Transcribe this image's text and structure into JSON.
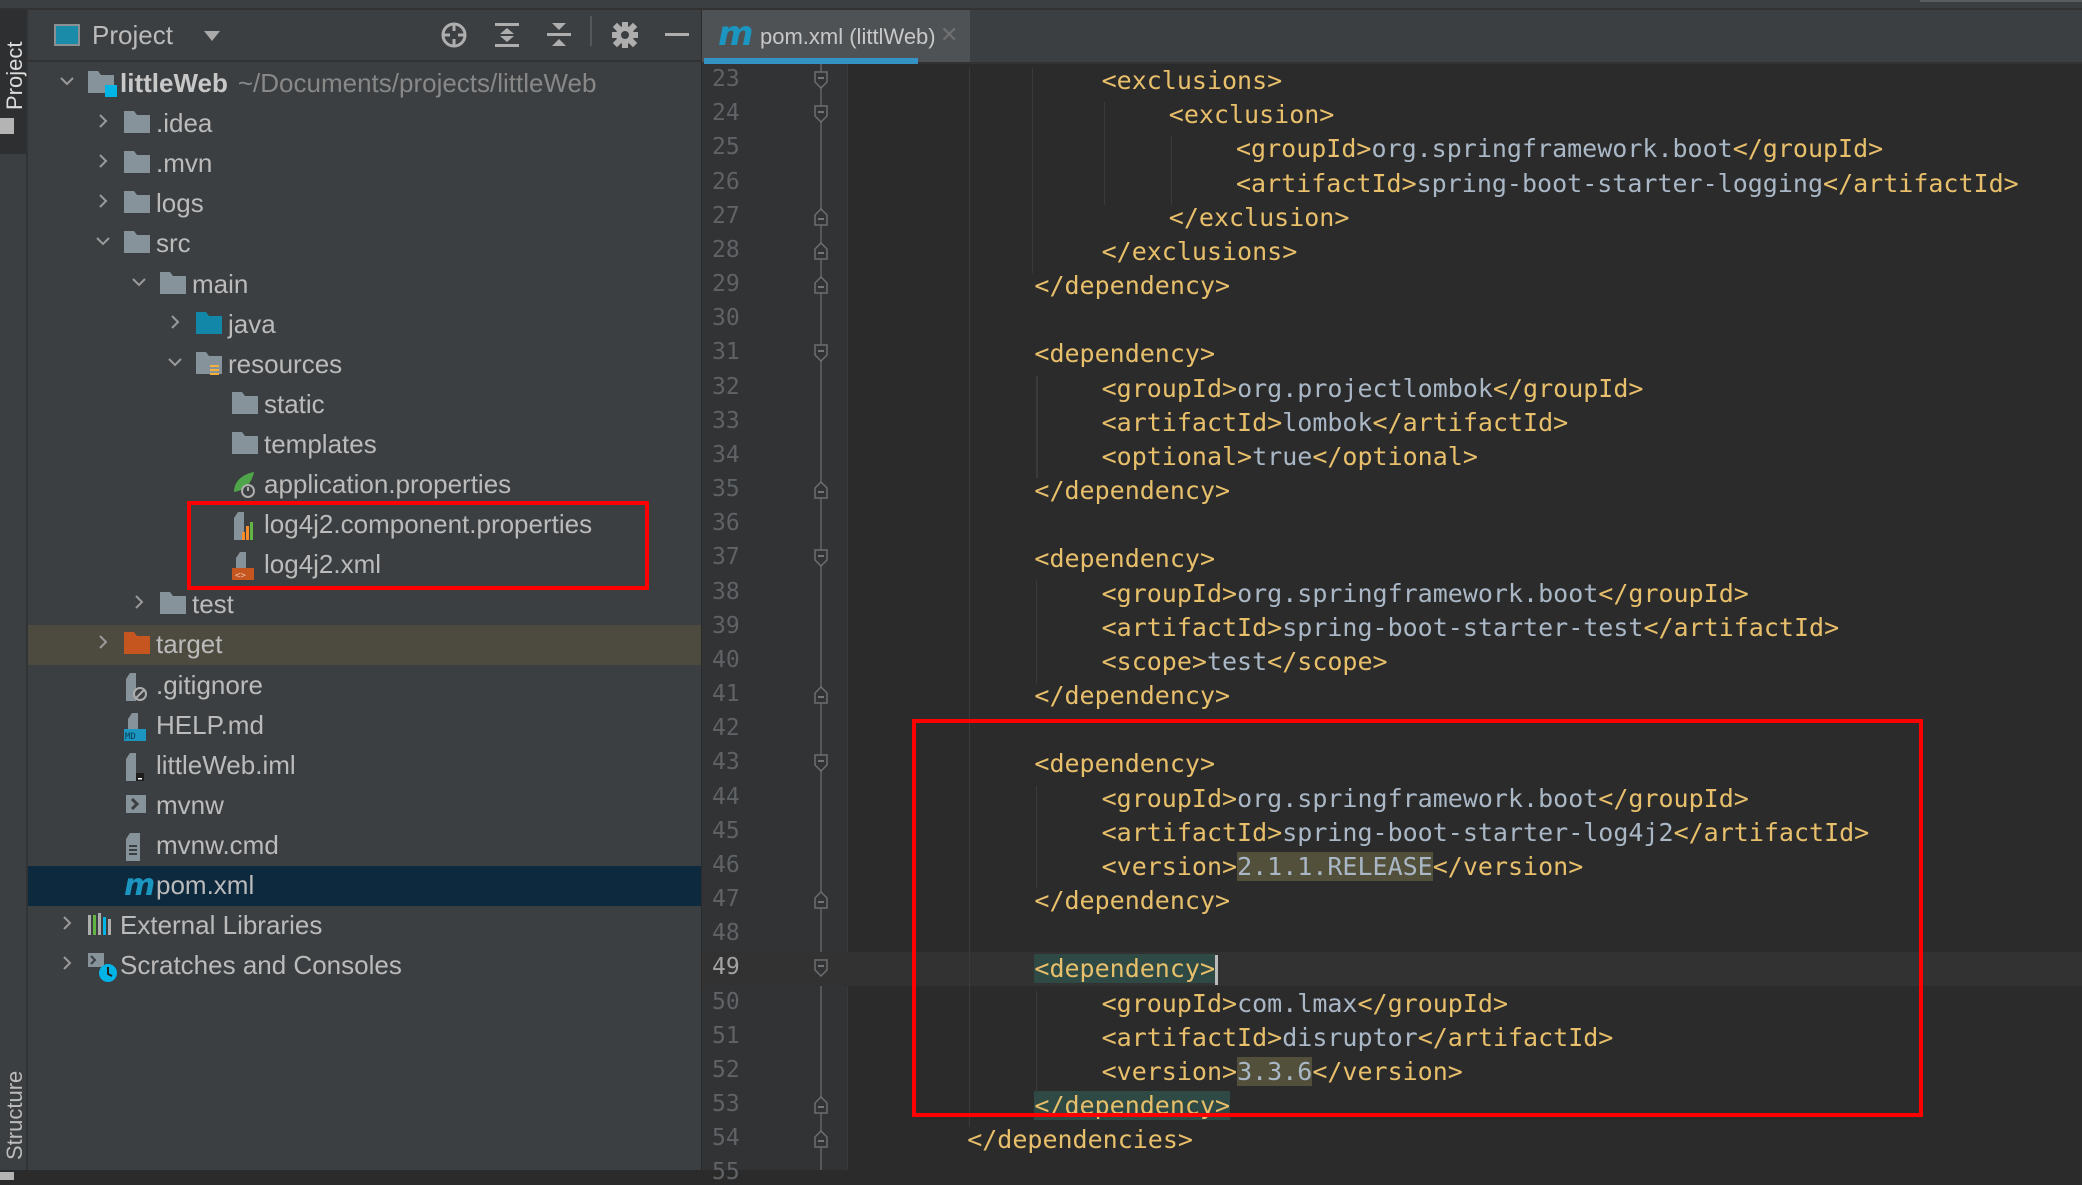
{
  "window": {
    "left_strip": {
      "top_tab": "Project",
      "bottom_tab": "Structure"
    }
  },
  "project_panel": {
    "title": "Project",
    "toolbar": {
      "locate_icon": "crosshair-icon",
      "expand_all_icon": "expand-all-icon",
      "collapse_all_icon": "collapse-all-icon",
      "settings_icon": "gear-icon",
      "hide_icon": "minimize-icon"
    },
    "tree": [
      {
        "label": "littleWeb",
        "path": "~/Documents/projects/littleWeb",
        "depth": 0,
        "expanded": true,
        "icon": "module-folder-icon",
        "bold": true
      },
      {
        "label": ".idea",
        "depth": 1,
        "expanded": false,
        "icon": "folder-icon"
      },
      {
        "label": ".mvn",
        "depth": 1,
        "expanded": false,
        "icon": "folder-icon"
      },
      {
        "label": "logs",
        "depth": 1,
        "expanded": false,
        "icon": "folder-icon"
      },
      {
        "label": "src",
        "depth": 1,
        "expanded": true,
        "icon": "folder-icon"
      },
      {
        "label": "main",
        "depth": 2,
        "expanded": true,
        "icon": "folder-icon"
      },
      {
        "label": "java",
        "depth": 3,
        "expanded": false,
        "icon": "source-folder-icon"
      },
      {
        "label": "resources",
        "depth": 3,
        "expanded": true,
        "icon": "resources-folder-icon"
      },
      {
        "label": "static",
        "depth": 4,
        "icon": "folder-icon"
      },
      {
        "label": "templates",
        "depth": 4,
        "icon": "folder-icon"
      },
      {
        "label": "application.properties",
        "depth": 4,
        "icon": "spring-properties-icon"
      },
      {
        "label": "log4j2.component.properties",
        "depth": 4,
        "icon": "properties-file-icon"
      },
      {
        "label": "log4j2.xml",
        "depth": 4,
        "icon": "xml-file-icon"
      },
      {
        "label": "test",
        "depth": 2,
        "expanded": false,
        "icon": "folder-icon"
      },
      {
        "label": "target",
        "depth": 1,
        "expanded": false,
        "icon": "excluded-folder-icon",
        "highlighted": true
      },
      {
        "label": ".gitignore",
        "depth": 1,
        "icon": "gitignore-file-icon"
      },
      {
        "label": "HELP.md",
        "depth": 1,
        "icon": "markdown-file-icon"
      },
      {
        "label": "littleWeb.iml",
        "depth": 1,
        "icon": "iml-file-icon"
      },
      {
        "label": "mvnw",
        "depth": 1,
        "icon": "shell-script-icon"
      },
      {
        "label": "mvnw.cmd",
        "depth": 1,
        "icon": "text-file-icon"
      },
      {
        "label": "pom.xml",
        "depth": 1,
        "icon": "maven-icon",
        "selected": true
      },
      {
        "label": "External Libraries",
        "depth": 0,
        "expanded": false,
        "icon": "libraries-icon"
      },
      {
        "label": "Scratches and Consoles",
        "depth": 0,
        "expanded": false,
        "icon": "scratches-icon"
      }
    ]
  },
  "editor": {
    "tab": {
      "label": "pom.xml (littlWeb)",
      "icon": "maven-icon",
      "close_icon": "close-icon"
    },
    "current_line": 49,
    "lines": [
      {
        "n": 23,
        "indent": 3,
        "parts": [
          [
            "tag",
            "<exclusions>"
          ]
        ],
        "fold": "open"
      },
      {
        "n": 24,
        "indent": 4,
        "parts": [
          [
            "tag",
            "<exclusion>"
          ]
        ],
        "fold": "open"
      },
      {
        "n": 25,
        "indent": 5,
        "parts": [
          [
            "tag",
            "<groupId>"
          ],
          [
            "txt",
            "org.springframework.boot"
          ],
          [
            "tag",
            "</groupId>"
          ]
        ]
      },
      {
        "n": 26,
        "indent": 5,
        "parts": [
          [
            "tag",
            "<artifactId>"
          ],
          [
            "txt",
            "spring-boot-starter-logging"
          ],
          [
            "tag",
            "</artifactId>"
          ]
        ]
      },
      {
        "n": 27,
        "indent": 4,
        "parts": [
          [
            "tag",
            "</exclusion>"
          ]
        ],
        "fold": "close"
      },
      {
        "n": 28,
        "indent": 3,
        "parts": [
          [
            "tag",
            "</exclusions>"
          ]
        ],
        "fold": "close"
      },
      {
        "n": 29,
        "indent": 2,
        "parts": [
          [
            "tag",
            "</dependency>"
          ]
        ],
        "fold": "close"
      },
      {
        "n": 30,
        "indent": 0,
        "parts": []
      },
      {
        "n": 31,
        "indent": 2,
        "parts": [
          [
            "tag",
            "<dependency>"
          ]
        ],
        "fold": "open"
      },
      {
        "n": 32,
        "indent": 3,
        "parts": [
          [
            "tag",
            "<groupId>"
          ],
          [
            "txt",
            "org.projectlombok"
          ],
          [
            "tag",
            "</groupId>"
          ]
        ]
      },
      {
        "n": 33,
        "indent": 3,
        "parts": [
          [
            "tag",
            "<artifactId>"
          ],
          [
            "txt",
            "lombok"
          ],
          [
            "tag",
            "</artifactId>"
          ]
        ]
      },
      {
        "n": 34,
        "indent": 3,
        "parts": [
          [
            "tag",
            "<optional>"
          ],
          [
            "txt",
            "true"
          ],
          [
            "tag",
            "</optional>"
          ]
        ]
      },
      {
        "n": 35,
        "indent": 2,
        "parts": [
          [
            "tag",
            "</dependency>"
          ]
        ],
        "fold": "close"
      },
      {
        "n": 36,
        "indent": 0,
        "parts": []
      },
      {
        "n": 37,
        "indent": 2,
        "parts": [
          [
            "tag",
            "<dependency>"
          ]
        ],
        "fold": "open"
      },
      {
        "n": 38,
        "indent": 3,
        "parts": [
          [
            "tag",
            "<groupId>"
          ],
          [
            "txt",
            "org.springframework.boot"
          ],
          [
            "tag",
            "</groupId>"
          ]
        ]
      },
      {
        "n": 39,
        "indent": 3,
        "parts": [
          [
            "tag",
            "<artifactId>"
          ],
          [
            "txt",
            "spring-boot-starter-test"
          ],
          [
            "tag",
            "</artifactId>"
          ]
        ]
      },
      {
        "n": 40,
        "indent": 3,
        "parts": [
          [
            "tag",
            "<scope>"
          ],
          [
            "txt",
            "test"
          ],
          [
            "tag",
            "</scope>"
          ]
        ]
      },
      {
        "n": 41,
        "indent": 2,
        "parts": [
          [
            "tag",
            "</dependency>"
          ]
        ],
        "fold": "close"
      },
      {
        "n": 42,
        "indent": 0,
        "parts": []
      },
      {
        "n": 43,
        "indent": 2,
        "parts": [
          [
            "tag",
            "<dependency>"
          ]
        ],
        "fold": "open"
      },
      {
        "n": 44,
        "indent": 3,
        "parts": [
          [
            "tag",
            "<groupId>"
          ],
          [
            "txt",
            "org.springframework.boot"
          ],
          [
            "tag",
            "</groupId>"
          ]
        ]
      },
      {
        "n": 45,
        "indent": 3,
        "parts": [
          [
            "tag",
            "<artifactId>"
          ],
          [
            "txt",
            "spring-boot-starter-log4j2"
          ],
          [
            "tag",
            "</artifactId>"
          ]
        ]
      },
      {
        "n": 46,
        "indent": 3,
        "parts": [
          [
            "tag",
            "<version>"
          ],
          [
            "ver",
            "2.1.1.RELEASE"
          ],
          [
            "tag",
            "</version>"
          ]
        ]
      },
      {
        "n": 47,
        "indent": 2,
        "parts": [
          [
            "tag",
            "</dependency>"
          ]
        ],
        "fold": "close"
      },
      {
        "n": 48,
        "indent": 0,
        "parts": []
      },
      {
        "n": 49,
        "indent": 2,
        "parts": [
          [
            "match",
            "<dependency>"
          ],
          [
            "cursor",
            ""
          ]
        ],
        "fold": "open"
      },
      {
        "n": 50,
        "indent": 3,
        "parts": [
          [
            "tag",
            "<groupId>"
          ],
          [
            "txt",
            "com.lmax"
          ],
          [
            "tag",
            "</groupId>"
          ]
        ]
      },
      {
        "n": 51,
        "indent": 3,
        "parts": [
          [
            "tag",
            "<artifactId>"
          ],
          [
            "txt",
            "disruptor"
          ],
          [
            "tag",
            "</artifactId>"
          ]
        ]
      },
      {
        "n": 52,
        "indent": 3,
        "parts": [
          [
            "tag",
            "<version>"
          ],
          [
            "ver",
            "3.3.6"
          ],
          [
            "tag",
            "</version>"
          ]
        ]
      },
      {
        "n": 53,
        "indent": 2,
        "parts": [
          [
            "match",
            "</dependency>"
          ]
        ],
        "fold": "close"
      },
      {
        "n": 54,
        "indent": 1,
        "parts": [
          [
            "tag",
            "</dependencies>"
          ]
        ],
        "fold": "close"
      },
      {
        "n": 55,
        "indent": 0,
        "parts": []
      }
    ]
  },
  "annotations": [
    {
      "target": "tree-files-log4j2",
      "color": "#ff0000"
    },
    {
      "target": "code-new-dependencies",
      "color": "#ff0000"
    }
  ],
  "colors": {
    "tag": "#e8bf6a",
    "text": "#a9b7c6",
    "accent": "#3592c4",
    "selection": "#0d293e",
    "annotation": "#ff0000"
  }
}
